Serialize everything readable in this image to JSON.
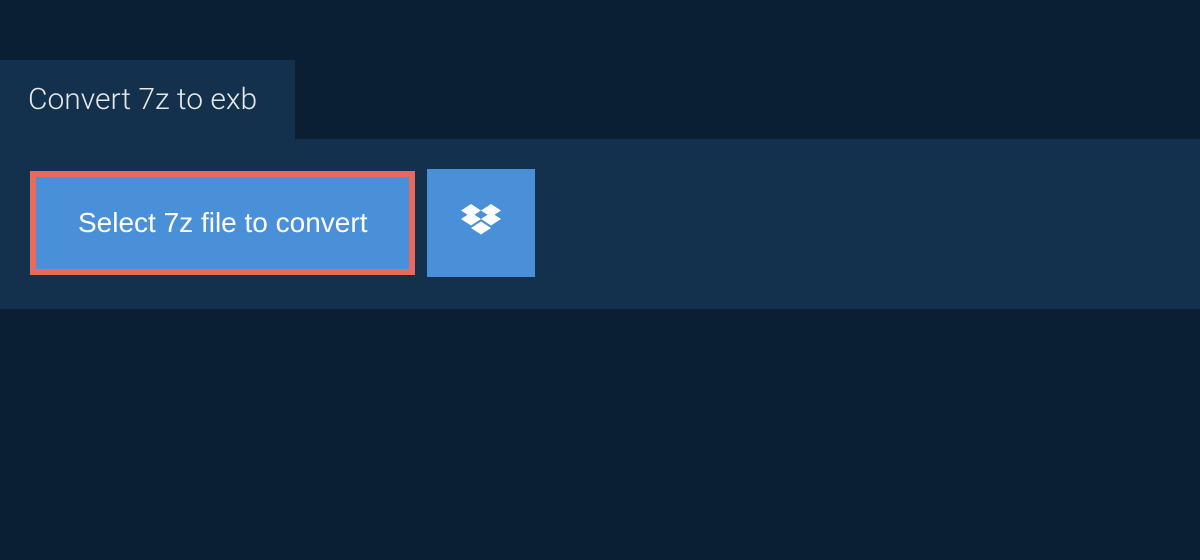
{
  "tab": {
    "title": "Convert 7z to exb"
  },
  "actions": {
    "select_file_label": "Select 7z file to convert"
  },
  "colors": {
    "background": "#0a1f33",
    "panel": "#13304d",
    "button": "#4a90d9",
    "highlight_border": "#e86a5c"
  }
}
